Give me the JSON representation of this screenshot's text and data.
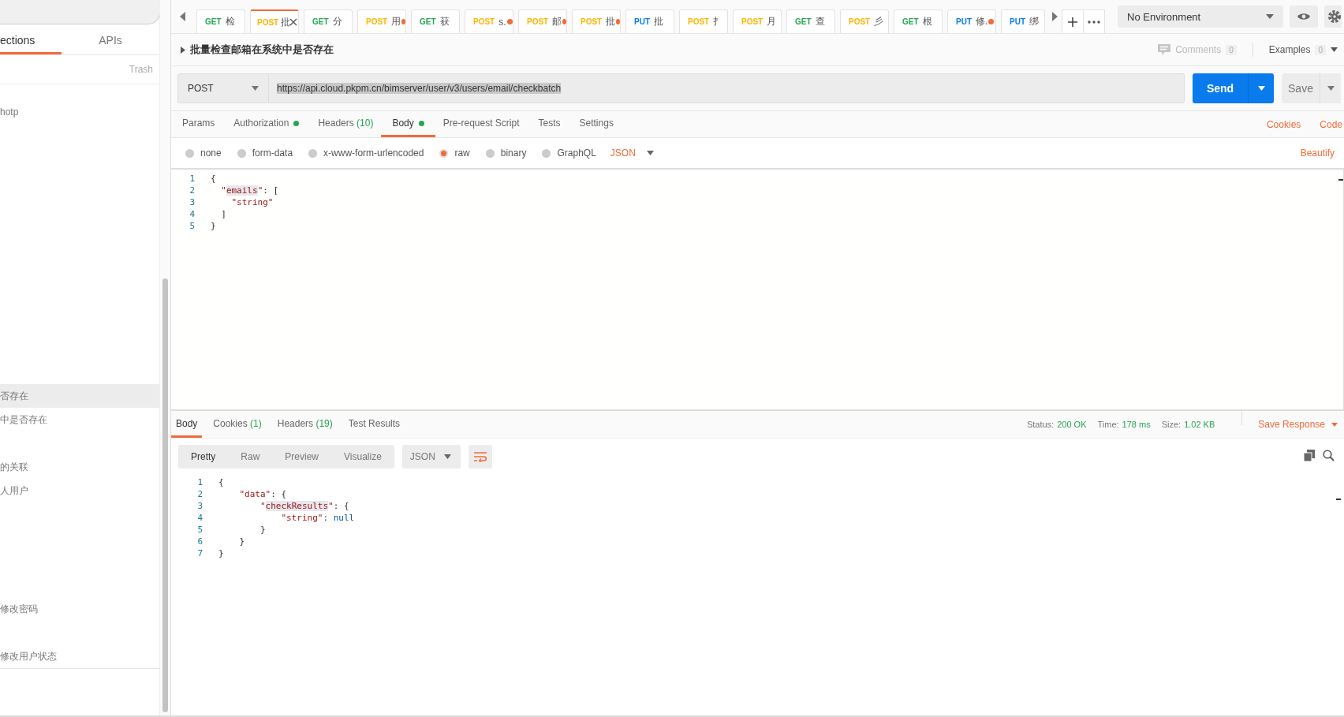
{
  "sidebar": {
    "tabs": [
      {
        "label": "ections",
        "selected": true
      },
      {
        "label": "APIs",
        "selected": false
      }
    ],
    "trash": "Trash",
    "items": [
      {
        "label": "hotp",
        "selected": false
      },
      {
        "label": "否存在",
        "selected": true
      },
      {
        "label": "中是否存在",
        "selected": false
      },
      {
        "label": "的关联",
        "selected": false
      },
      {
        "label": "人用户",
        "selected": false
      },
      {
        "label": "修改密码",
        "selected": false
      },
      {
        "label": "修改用户状态",
        "selected": false
      }
    ]
  },
  "request_tabs": [
    {
      "method": "GET",
      "color": "#26a550",
      "name": "检",
      "unsaved": false,
      "selected": false
    },
    {
      "method": "POST",
      "color": "#ffb400",
      "name": "批",
      "unsaved": false,
      "selected": true
    },
    {
      "method": "GET",
      "color": "#26a550",
      "name": "分",
      "unsaved": false,
      "selected": false
    },
    {
      "method": "POST",
      "color": "#ffb400",
      "name": "用",
      "unsaved": true,
      "selected": false
    },
    {
      "method": "GET",
      "color": "#26a550",
      "name": "获",
      "unsaved": false,
      "selected": false
    },
    {
      "method": "POST",
      "color": "#ffb400",
      "name": "s.",
      "unsaved": true,
      "selected": false
    },
    {
      "method": "POST",
      "color": "#ffb400",
      "name": "邮",
      "unsaved": true,
      "selected": false
    },
    {
      "method": "POST",
      "color": "#ffb400",
      "name": "批",
      "unsaved": true,
      "selected": false
    },
    {
      "method": "PUT",
      "color": "#097bed",
      "name": "批",
      "unsaved": false,
      "selected": false
    },
    {
      "method": "POST",
      "color": "#ffb400",
      "name": "扌",
      "unsaved": false,
      "selected": false
    },
    {
      "method": "POST",
      "color": "#ffb400",
      "name": "月",
      "unsaved": false,
      "selected": false
    },
    {
      "method": "GET",
      "color": "#26a550",
      "name": "查",
      "unsaved": false,
      "selected": false
    },
    {
      "method": "POST",
      "color": "#ffb400",
      "name": "彡",
      "unsaved": false,
      "selected": false
    },
    {
      "method": "GET",
      "color": "#26a550",
      "name": "根",
      "unsaved": false,
      "selected": false
    },
    {
      "method": "PUT",
      "color": "#097bed",
      "name": "修.",
      "unsaved": true,
      "selected": false
    },
    {
      "method": "PUT",
      "color": "#097bed",
      "name": "绑",
      "unsaved": false,
      "selected": false
    }
  ],
  "environment": {
    "value": "No Environment"
  },
  "request": {
    "title": "批量检查邮箱在系统中是否存在",
    "comments": {
      "label": "Comments",
      "count": "0"
    },
    "examples": {
      "label": "Examples",
      "count": "0"
    },
    "method": "POST",
    "url": "https://api.cloud.pkpm.cn/bimserver/user/v3/users/email/checkbatch",
    "send": "Send",
    "save": "Save"
  },
  "request_sections": [
    {
      "label": "Params",
      "indicator": false,
      "selected": false
    },
    {
      "label": "Authorization",
      "indicator": true,
      "selected": false
    },
    {
      "label": "Headers",
      "count": "(10)",
      "indicator": false,
      "selected": false
    },
    {
      "label": "Body",
      "indicator": true,
      "selected": true
    },
    {
      "label": "Pre-request Script",
      "indicator": false,
      "selected": false
    },
    {
      "label": "Tests",
      "indicator": false,
      "selected": false
    },
    {
      "label": "Settings",
      "indicator": false,
      "selected": false
    }
  ],
  "request_links": [
    "Cookies",
    "Code"
  ],
  "body_types": [
    {
      "label": "none",
      "selected": false
    },
    {
      "label": "form-data",
      "selected": false
    },
    {
      "label": "x-www-form-urlencoded",
      "selected": false
    },
    {
      "label": "raw",
      "selected": true
    },
    {
      "label": "binary",
      "selected": false
    },
    {
      "label": "GraphQL",
      "selected": false
    }
  ],
  "body_format": "JSON",
  "beautify": "Beautify",
  "request_body": [
    {
      "number": "1",
      "tokens": [
        {
          "kind": "punct",
          "text": "{"
        }
      ]
    },
    {
      "number": "2",
      "tokens": [
        {
          "kind": "string",
          "text": "  \""
        },
        {
          "kind": "string",
          "text": "emails",
          "highlighted": true
        },
        {
          "kind": "string",
          "text": "\""
        },
        {
          "kind": "punct",
          "text": ": ["
        }
      ]
    },
    {
      "number": "3",
      "tokens": [
        {
          "kind": "string",
          "text": "    \"string\""
        }
      ]
    },
    {
      "number": "4",
      "tokens": [
        {
          "kind": "punct",
          "text": "  ]"
        }
      ]
    },
    {
      "number": "5",
      "tokens": [
        {
          "kind": "punct",
          "text": "}"
        }
      ]
    }
  ],
  "response_tabs": [
    {
      "label": "Body",
      "selected": true
    },
    {
      "label": "Cookies",
      "count": "(1)",
      "selected": false
    },
    {
      "label": "Headers",
      "count": "(19)",
      "selected": false
    },
    {
      "label": "Test Results",
      "selected": false
    }
  ],
  "response_status": [
    {
      "label": "Status:",
      "value": "200 OK"
    },
    {
      "label": "Time:",
      "value": "178 ms"
    },
    {
      "label": "Size:",
      "value": "1.02 KB"
    }
  ],
  "save_response": "Save Response",
  "view_modes": [
    {
      "label": "Pretty",
      "selected": true
    },
    {
      "label": "Raw",
      "selected": false
    },
    {
      "label": "Preview",
      "selected": false
    },
    {
      "label": "Visualize",
      "selected": false
    }
  ],
  "response_format": "JSON",
  "wrap": {
    "on": true
  },
  "response_body": [
    {
      "number": "1",
      "tokens": [
        {
          "kind": "punct",
          "text": "{"
        }
      ]
    },
    {
      "number": "2",
      "tokens": [
        {
          "kind": "string",
          "text": "    \"data\""
        },
        {
          "kind": "punct",
          "text": ": {"
        }
      ]
    },
    {
      "number": "3",
      "tokens": [
        {
          "kind": "string",
          "text": "        \""
        },
        {
          "kind": "string",
          "text": "checkResults",
          "highlighted": true
        },
        {
          "kind": "string",
          "text": "\""
        },
        {
          "kind": "punct",
          "text": ": {"
        }
      ]
    },
    {
      "number": "4",
      "tokens": [
        {
          "kind": "string",
          "text": "            \"string\""
        },
        {
          "kind": "punct",
          "text": ": "
        },
        {
          "kind": "null",
          "text": "null"
        }
      ]
    },
    {
      "number": "5",
      "tokens": [
        {
          "kind": "punct",
          "text": "        }"
        }
      ]
    },
    {
      "number": "6",
      "tokens": [
        {
          "kind": "punct",
          "text": "    }"
        }
      ]
    },
    {
      "number": "7",
      "tokens": [
        {
          "kind": "punct",
          "text": "}"
        }
      ]
    }
  ]
}
